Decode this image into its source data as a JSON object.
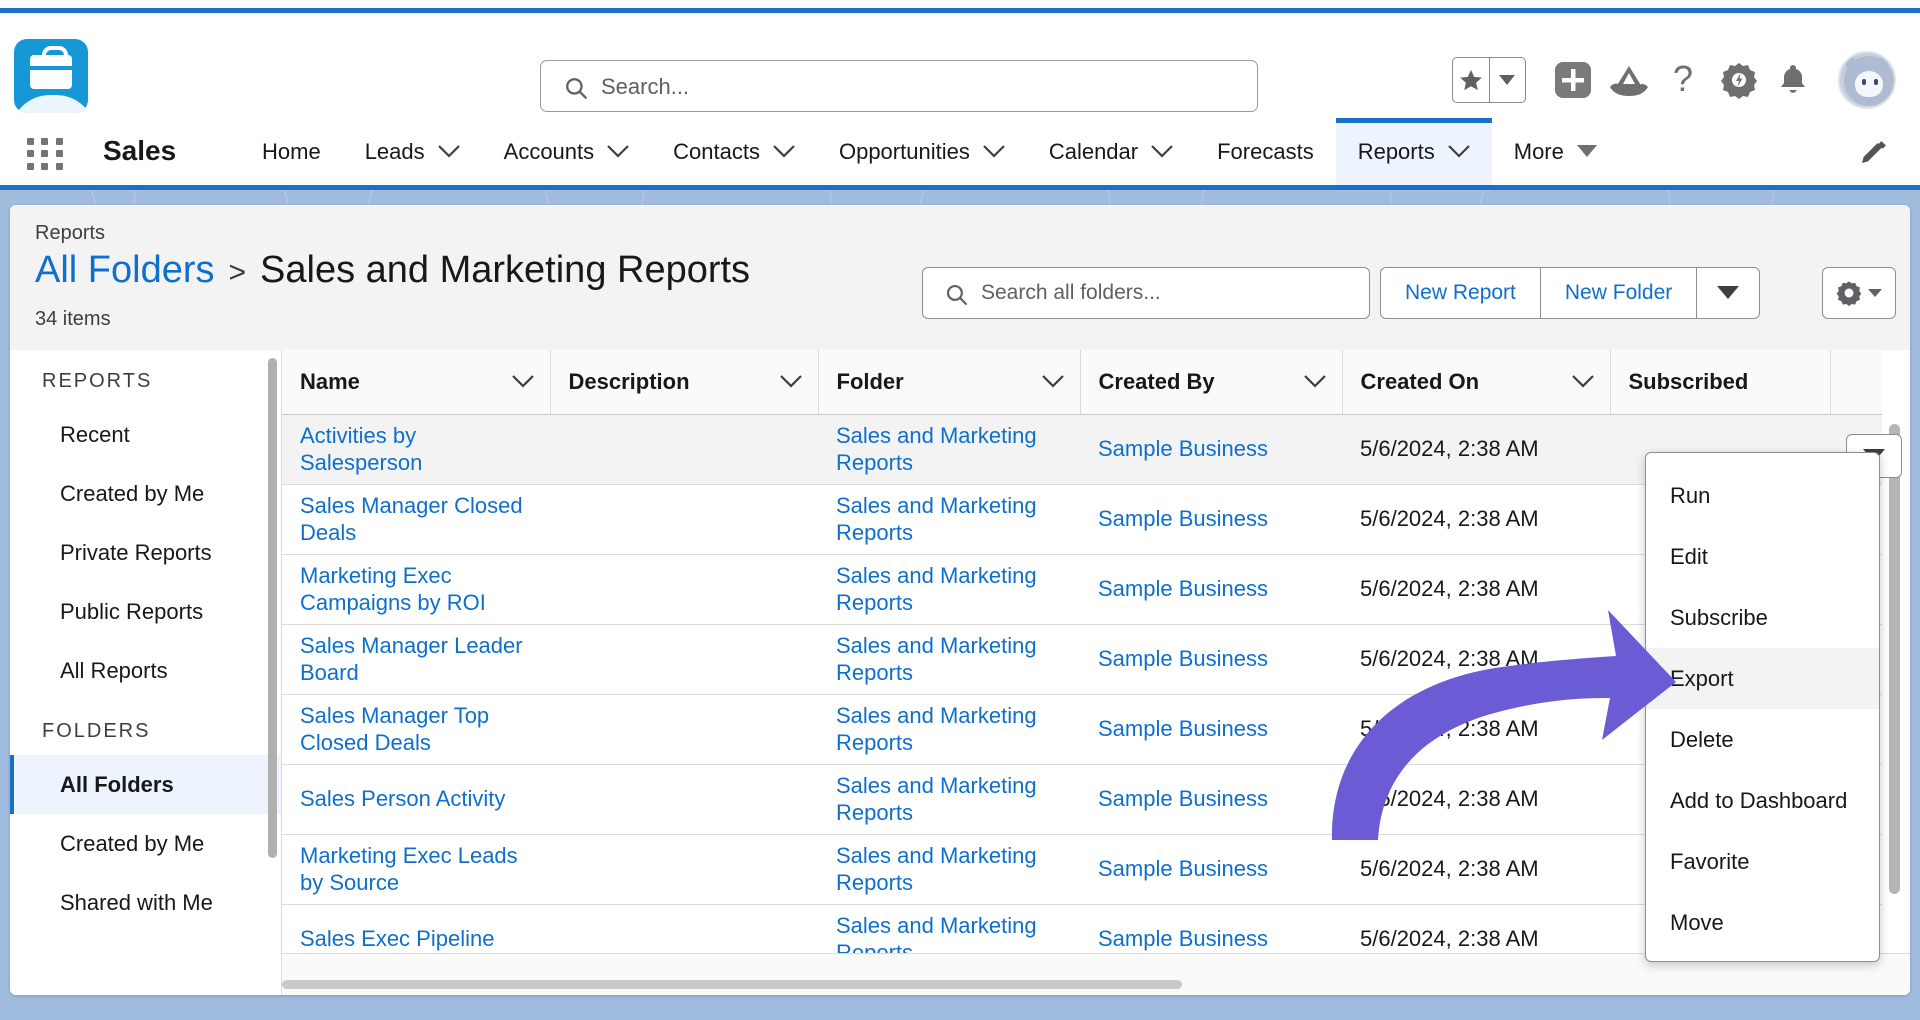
{
  "colors": {
    "brand_blue": "#1b6fc4",
    "link_blue": "#0f6fcc",
    "logo_blue": "#1798d6",
    "page_bg": "#9fbbde",
    "annotation_purple": "#6B5CD6",
    "row_alt": "#f3f3f3"
  },
  "global_header": {
    "logo_name": "briefcase-cloud-logo",
    "search": {
      "placeholder": "Search...",
      "value": ""
    },
    "icons": [
      {
        "name": "favorites-star-icon",
        "glyph": "star"
      },
      {
        "name": "favorites-dropdown-icon",
        "glyph": "caret-down"
      },
      {
        "name": "add-plus-icon",
        "glyph": "plus"
      },
      {
        "name": "mountain-cloud-icon",
        "glyph": "mountain"
      },
      {
        "name": "help-question-icon",
        "glyph": "question"
      },
      {
        "name": "setup-gear-icon",
        "glyph": "gear"
      },
      {
        "name": "notifications-bell-icon",
        "glyph": "bell"
      },
      {
        "name": "user-avatar",
        "glyph": "avatar"
      }
    ]
  },
  "nav": {
    "app_name": "Sales",
    "waffle_name": "app-launcher-waffle-icon",
    "edit_icon": "edit-pencil-icon",
    "items": [
      {
        "label": "Home",
        "has_caret": false,
        "active": false
      },
      {
        "label": "Leads",
        "has_caret": true,
        "active": false
      },
      {
        "label": "Accounts",
        "has_caret": true,
        "active": false
      },
      {
        "label": "Contacts",
        "has_caret": true,
        "active": false
      },
      {
        "label": "Opportunities",
        "has_caret": true,
        "active": false
      },
      {
        "label": "Calendar",
        "has_caret": true,
        "active": false
      },
      {
        "label": "Forecasts",
        "has_caret": false,
        "active": false
      },
      {
        "label": "Reports",
        "has_caret": true,
        "active": true
      },
      {
        "label": "More",
        "has_caret": true,
        "active": false
      }
    ]
  },
  "page": {
    "breadcrumb": "Reports",
    "title_link": "All Folders",
    "title_separator": ">",
    "title_current": "Sales and Marketing Reports",
    "item_count": "34 items",
    "folder_search": {
      "placeholder": "Search all folders...",
      "value": ""
    },
    "buttons": {
      "new_report": "New Report",
      "new_folder": "New Folder",
      "more_caret": "caret-down-icon",
      "gear": "list-settings-gear-icon"
    }
  },
  "sidebar": {
    "sections": [
      {
        "heading": "REPORTS",
        "items": [
          {
            "label": "Recent",
            "active": false
          },
          {
            "label": "Created by Me",
            "active": false
          },
          {
            "label": "Private Reports",
            "active": false
          },
          {
            "label": "Public Reports",
            "active": false
          },
          {
            "label": "All Reports",
            "active": false
          }
        ]
      },
      {
        "heading": "FOLDERS",
        "items": [
          {
            "label": "All Folders",
            "active": true
          },
          {
            "label": "Created by Me",
            "active": false
          },
          {
            "label": "Shared with Me",
            "active": false
          }
        ]
      }
    ]
  },
  "table": {
    "columns": [
      {
        "label": "Name",
        "sortable": true
      },
      {
        "label": "Description",
        "sortable": true
      },
      {
        "label": "Folder",
        "sortable": true
      },
      {
        "label": "Created By",
        "sortable": true
      },
      {
        "label": "Created On",
        "sortable": true
      },
      {
        "label": "Subscribed",
        "sortable": false
      }
    ],
    "rows": [
      {
        "name": "Activities by Salesperson",
        "description": "",
        "folder": "Sales and Marketing Reports",
        "created_by": "Sample Business",
        "created_on": "5/6/2024, 2:38 AM",
        "subscribed": ""
      },
      {
        "name": "Sales Manager Closed Deals",
        "description": "",
        "folder": "Sales and Marketing Reports",
        "created_by": "Sample Business",
        "created_on": "5/6/2024, 2:38 AM",
        "subscribed": ""
      },
      {
        "name": "Marketing Exec Campaigns by ROI",
        "description": "",
        "folder": "Sales and Marketing Reports",
        "created_by": "Sample Business",
        "created_on": "5/6/2024, 2:38 AM",
        "subscribed": ""
      },
      {
        "name": "Sales Manager Leader Board",
        "description": "",
        "folder": "Sales and Marketing Reports",
        "created_by": "Sample Business",
        "created_on": "5/6/2024, 2:38 AM",
        "subscribed": ""
      },
      {
        "name": "Sales Manager Top Closed Deals",
        "description": "",
        "folder": "Sales and Marketing Reports",
        "created_by": "Sample Business",
        "created_on": "5/6/2024, 2:38 AM",
        "subscribed": ""
      },
      {
        "name": "Sales Person Activity",
        "description": "",
        "folder": "Sales and Marketing Reports",
        "created_by": "Sample Business",
        "created_on": "5/6/2024, 2:38 AM",
        "subscribed": ""
      },
      {
        "name": "Marketing Exec Leads by Source",
        "description": "",
        "folder": "Sales and Marketing Reports",
        "created_by": "Sample Business",
        "created_on": "5/6/2024, 2:38 AM",
        "subscribed": ""
      },
      {
        "name": "Sales Exec Pipeline",
        "description": "",
        "folder": "Sales and Marketing Reports",
        "created_by": "Sample Business",
        "created_on": "5/6/2024, 2:38 AM",
        "subscribed": ""
      }
    ]
  },
  "row_menu": {
    "trigger_icon": "row-actions-caret-icon",
    "items": [
      {
        "label": "Run",
        "highlighted": false
      },
      {
        "label": "Edit",
        "highlighted": false
      },
      {
        "label": "Subscribe",
        "highlighted": false
      },
      {
        "label": "Export",
        "highlighted": true
      },
      {
        "label": "Delete",
        "highlighted": false
      },
      {
        "label": "Add to Dashboard",
        "highlighted": false
      },
      {
        "label": "Favorite",
        "highlighted": false
      },
      {
        "label": "Move",
        "highlighted": false
      }
    ]
  },
  "annotation": {
    "name": "purple-curved-arrow",
    "points_to": "Export"
  }
}
